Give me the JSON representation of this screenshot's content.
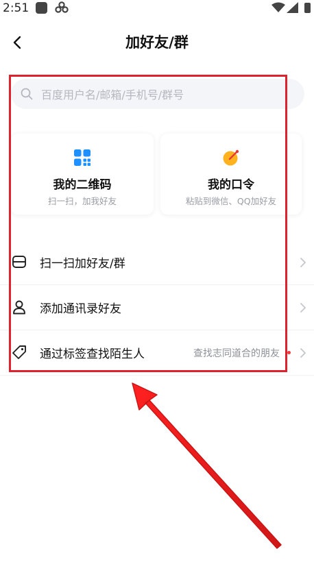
{
  "status_bar": {
    "time": "2:51",
    "icons": [
      "app-icon",
      "clover-icon",
      "wifi-icon",
      "signal-icon",
      "battery-icon"
    ]
  },
  "header": {
    "title": "加好友/群",
    "back_icon": "chevron-left-icon"
  },
  "search": {
    "placeholder": "百度用户名/邮箱/手机号/群号",
    "value": "",
    "icon": "search-icon"
  },
  "cards": [
    {
      "icon": "qr-code-icon",
      "title": "我的二维码",
      "subtitle": "扫一扫，加我好友",
      "icon_color": "#1e90ff"
    },
    {
      "icon": "command-token-icon",
      "title": "我的口令",
      "subtitle": "粘贴到微信、QQ加好友",
      "icon_color": "#ffb21e"
    }
  ],
  "list": [
    {
      "icon": "scan-icon",
      "label": "扫一扫加好友/群",
      "hint": ""
    },
    {
      "icon": "person-icon",
      "label": "添加通讯录好友",
      "hint": ""
    },
    {
      "icon": "tag-icon",
      "label": "通过标签查找陌生人",
      "hint": "查找志同道合的朋友",
      "has_red_dot": true
    }
  ],
  "colors": {
    "annotation_red": "#e0212b",
    "badge_dot": "#f03a3a",
    "search_bg": "#f4f5f9"
  }
}
